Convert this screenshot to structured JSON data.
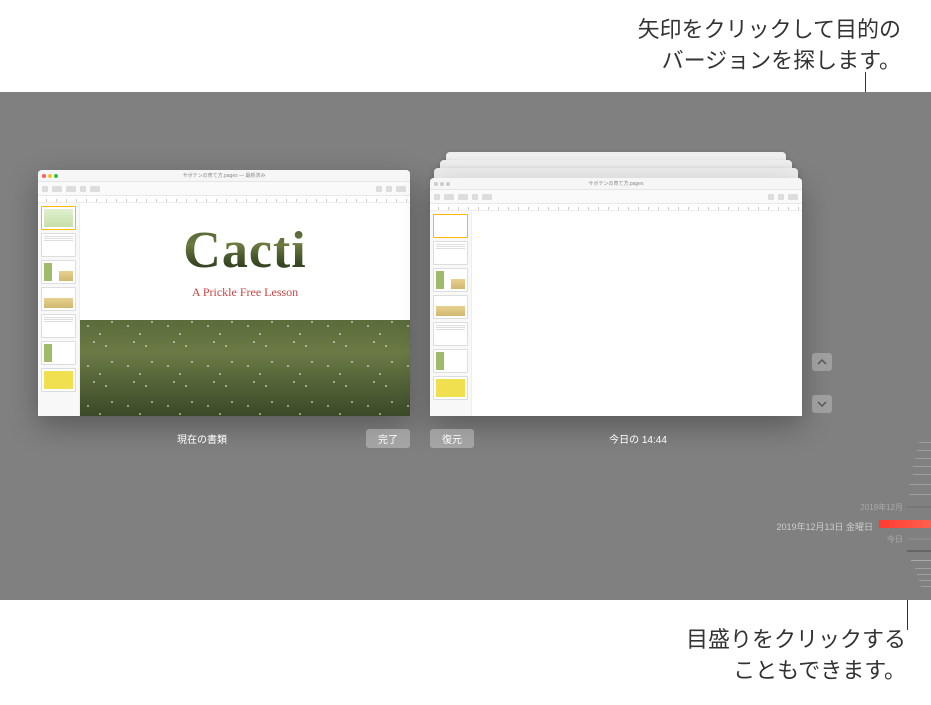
{
  "annotations": {
    "top_line1": "矢印をクリックして目的の",
    "top_line2": "バージョンを探します。",
    "bottom_line1": "目盛りをクリックする",
    "bottom_line2": "こともできます。"
  },
  "current_window": {
    "title": "サボテンの育て方.pages — 最新済み",
    "heading": "Cacti",
    "subheading": "A Prickle Free Lesson"
  },
  "previous_window": {
    "title": "サボテンの育て方.pages"
  },
  "labels": {
    "current": "現在の書類",
    "previous": "今日の 14:44"
  },
  "buttons": {
    "done": "完了",
    "restore": "復元"
  },
  "timeline": {
    "month_label": "2019年12月",
    "today_label": "今日",
    "selected_date": "2019年12月13日 金曜日"
  }
}
